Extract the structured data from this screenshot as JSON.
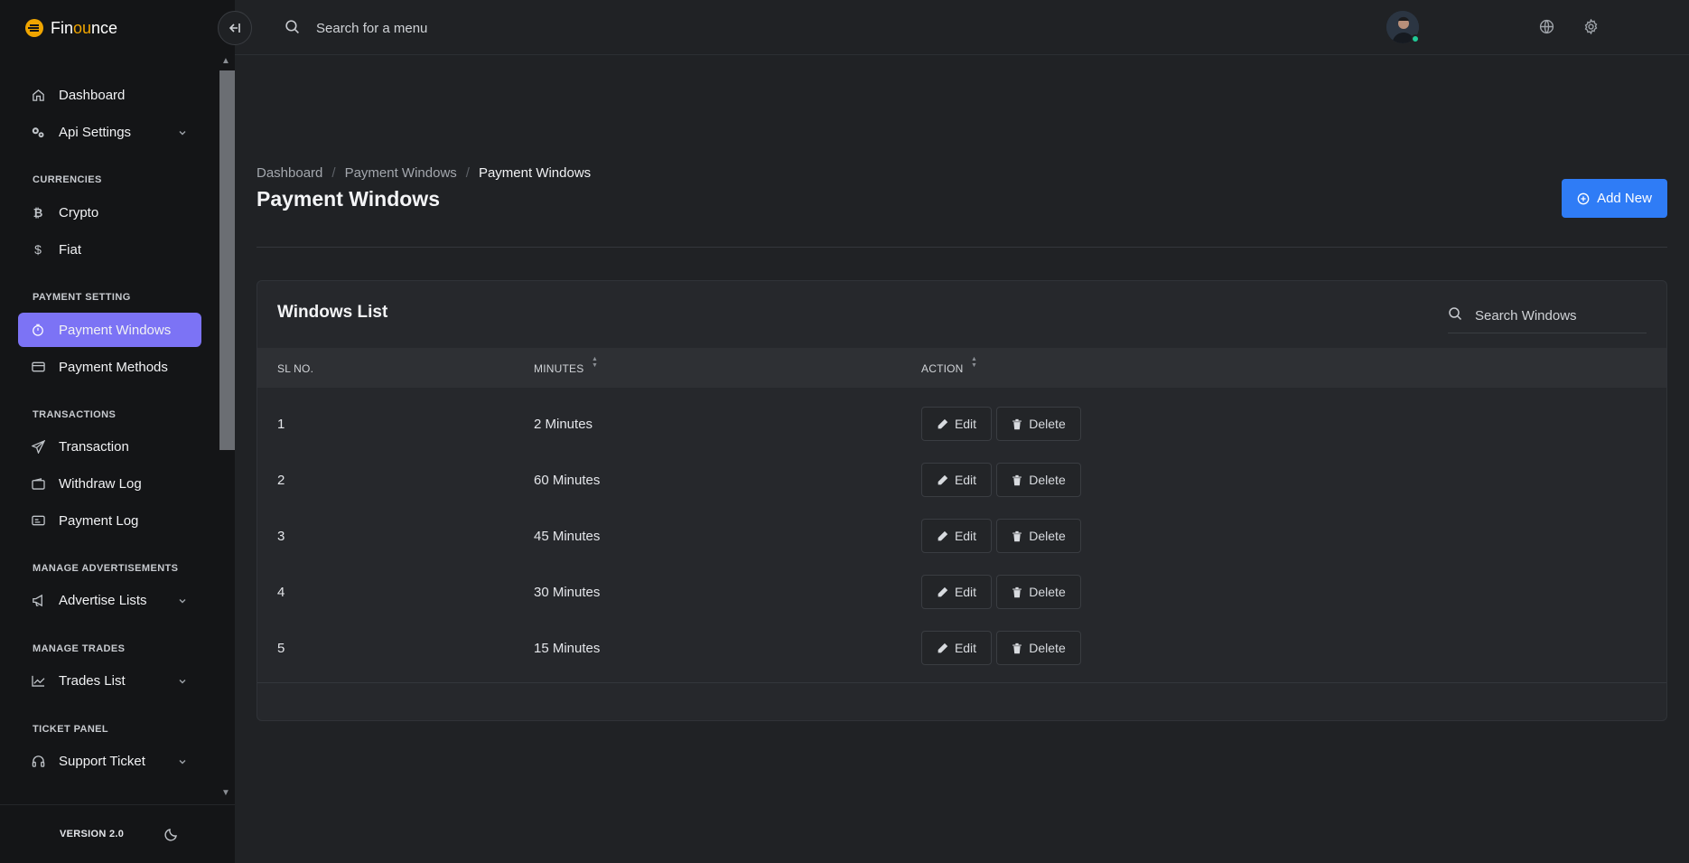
{
  "app": {
    "brand_prefix": "Fin",
    "brand_highlight": "ou",
    "brand_suffix": "nce"
  },
  "topbar": {
    "search_placeholder": "Search for a menu"
  },
  "sidebar": {
    "items": [
      {
        "label": "Dashboard",
        "icon": "home-icon"
      },
      {
        "label": "Api Settings",
        "icon": "gears-icon"
      },
      {
        "label": "Crypto",
        "icon": "bitcoin-icon"
      },
      {
        "label": "Fiat",
        "icon": "dollar-icon"
      },
      {
        "label": "Payment Windows",
        "icon": "timer-icon"
      },
      {
        "label": "Payment Methods",
        "icon": "card-icon"
      },
      {
        "label": "Transaction",
        "icon": "send-icon"
      },
      {
        "label": "Withdraw Log",
        "icon": "wallet-icon"
      },
      {
        "label": "Payment Log",
        "icon": "log-icon"
      },
      {
        "label": "Advertise Lists",
        "icon": "megaphone-icon"
      },
      {
        "label": "Trades List",
        "icon": "chart-line-icon"
      },
      {
        "label": "Support Ticket",
        "icon": "headset-icon"
      }
    ],
    "sections": [
      "CURRENCIES",
      "PAYMENT SETTING",
      "TRANSACTIONS",
      "MANAGE ADVERTISEMENTS",
      "MANAGE TRADES",
      "TICKET PANEL"
    ],
    "version": "VERSION 2.0",
    "active_color": "#7c73f5"
  },
  "page": {
    "breadcrumb": [
      "Dashboard",
      "Payment Windows",
      "Payment Windows"
    ],
    "title": "Payment Windows",
    "add_button": "Add New",
    "accent_color": "#2f7cf6"
  },
  "card": {
    "title": "Windows List",
    "search_placeholder": "Search Windows",
    "columns": [
      "SL NO.",
      "MINUTES",
      "ACTION"
    ],
    "edit_label": "Edit",
    "delete_label": "Delete",
    "rows": [
      {
        "sl": "1",
        "minutes": "2 Minutes"
      },
      {
        "sl": "2",
        "minutes": "60 Minutes"
      },
      {
        "sl": "3",
        "minutes": "45 Minutes"
      },
      {
        "sl": "4",
        "minutes": "30 Minutes"
      },
      {
        "sl": "5",
        "minutes": "15 Minutes"
      }
    ]
  }
}
